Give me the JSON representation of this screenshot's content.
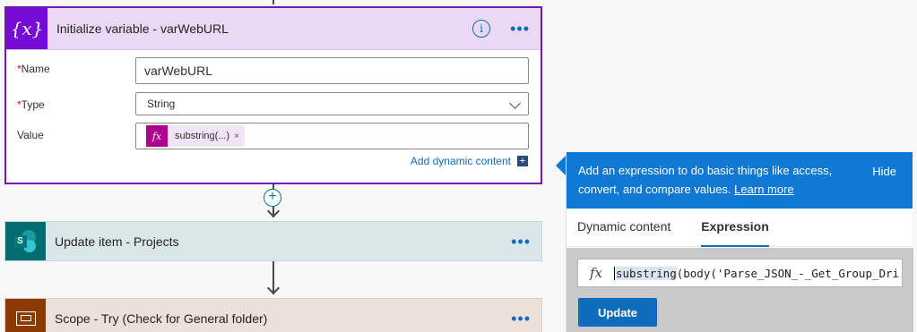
{
  "init_variable": {
    "title": "Initialize variable - varWebURL",
    "icon": "{x}",
    "name_label": "Name",
    "name_value": "varWebURL",
    "type_label": "Type",
    "type_value": "String",
    "value_label": "Value",
    "value_token": "substring(...)",
    "token_close": "×",
    "add_dynamic": "Add dynamic content",
    "required_mark": "*"
  },
  "update_item": {
    "title": "Update item - Projects",
    "icon": "sharepoint-icon"
  },
  "scope": {
    "title": "Scope - Try (Check for General folder)",
    "icon": "scope-icon"
  },
  "expression_panel": {
    "description": "Add an expression to do basic things like access, convert, and compare values.",
    "learn_more": "Learn more",
    "hide": "Hide",
    "tabs": [
      {
        "label": "Dynamic content",
        "active": false
      },
      {
        "label": "Expression",
        "active": true
      }
    ],
    "expression_fn": "substring",
    "expression_rest": "(body('Parse_JSON_-_Get_Group_Dri",
    "update_label": "Update"
  },
  "colors": {
    "variable_accent": "#770bd6",
    "sharepoint": "#036c70",
    "scope": "#8c3900",
    "primary": "#0f6cbd"
  }
}
